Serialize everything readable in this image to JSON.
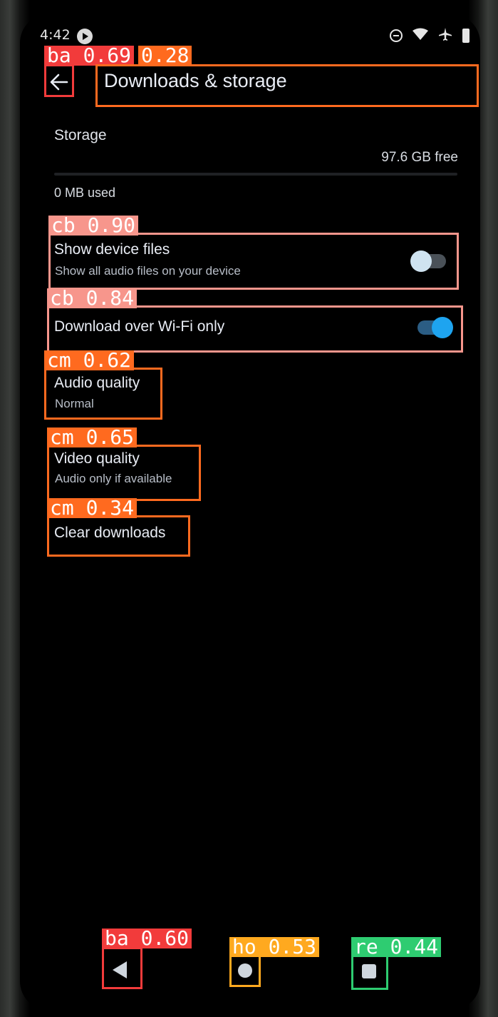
{
  "status_bar": {
    "time": "4:42"
  },
  "header": {
    "title": "Downloads & storage"
  },
  "storage": {
    "section_label": "Storage",
    "free_label": "97.6 GB free",
    "used_label": "0 MB used"
  },
  "settings": {
    "show_device_files": {
      "title": "Show device files",
      "subtitle": "Show all audio files on your device",
      "enabled": false
    },
    "download_wifi_only": {
      "title": "Download over Wi-Fi only",
      "enabled": true
    },
    "audio_quality": {
      "title": "Audio quality",
      "value": "Normal"
    },
    "video_quality": {
      "title": "Video quality",
      "value": "Audio only if available"
    },
    "clear_downloads": {
      "title": "Clear downloads"
    }
  },
  "detections": [
    {
      "tag": "ba 0.69",
      "color": "#f23b3b"
    },
    {
      "tag": "0.28",
      "color": "#ff6a1f"
    },
    {
      "tag": "cb 0.90",
      "color": "#f7968c"
    },
    {
      "tag": "cb 0.84",
      "color": "#f7968c"
    },
    {
      "tag": "cm 0.62",
      "color": "#ff6a1f"
    },
    {
      "tag": "cm 0.65",
      "color": "#ff6a1f"
    },
    {
      "tag": "cm 0.34",
      "color": "#ff6a1f"
    },
    {
      "tag": "ba 0.60",
      "color": "#f23b3b"
    },
    {
      "tag": "ho 0.53",
      "color": "#ffa91f"
    },
    {
      "tag": "re 0.44",
      "color": "#2ecc71"
    }
  ],
  "colors": {
    "accent": "#1ea4f0",
    "background": "#000000",
    "text_primary": "#e9edf5",
    "text_secondary": "#b8bec8"
  },
  "icons": {
    "back": "back-arrow-icon",
    "nav_back": "nav-back-icon",
    "nav_home": "nav-home-icon",
    "nav_recents": "nav-recents-icon"
  }
}
